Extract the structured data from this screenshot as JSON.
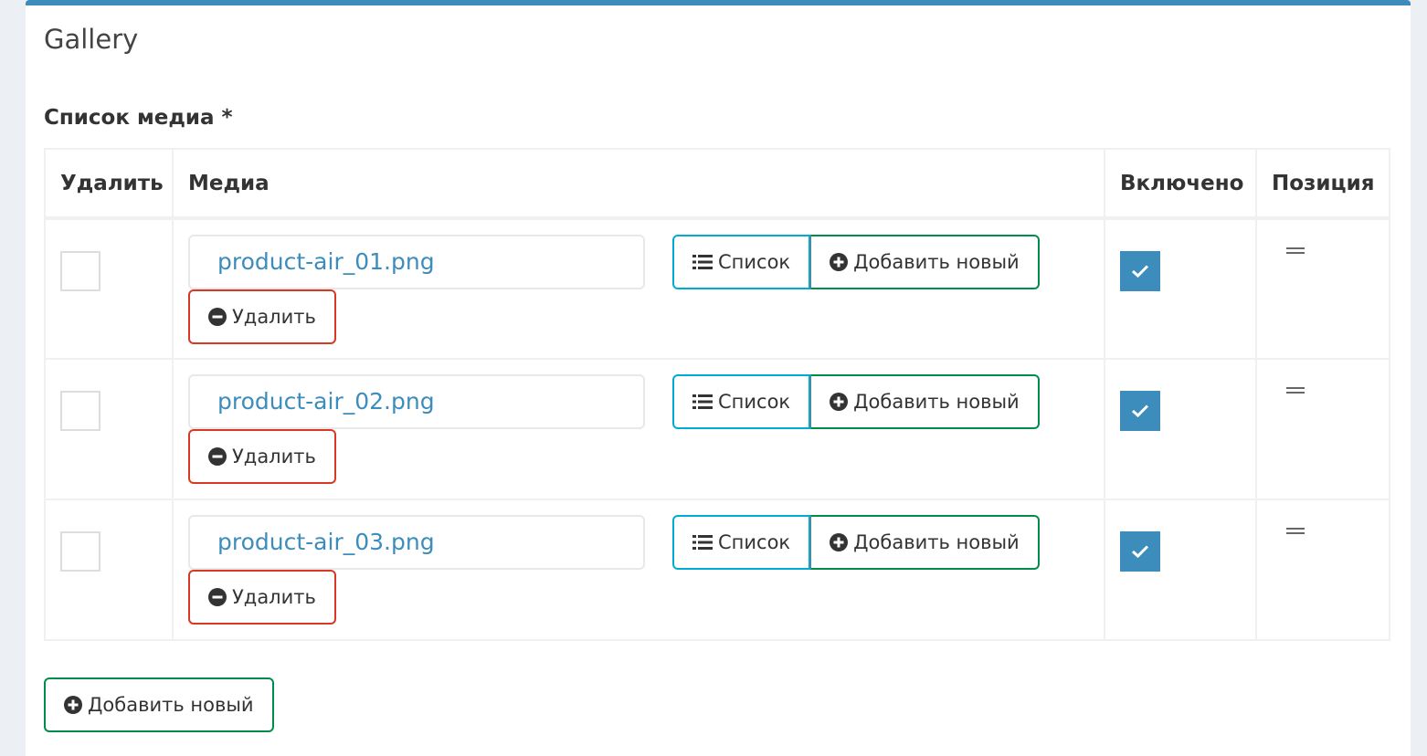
{
  "box": {
    "title": "Gallery"
  },
  "field": {
    "label": "Список медиа *"
  },
  "table": {
    "headers": {
      "delete": "Удалить",
      "media": "Медиа",
      "enabled": "Включено",
      "position": "Позиция"
    },
    "rows": [
      {
        "filename": "product-air_01.png",
        "delete_checked": false,
        "enabled": true
      },
      {
        "filename": "product-air_02.png",
        "delete_checked": false,
        "enabled": true
      },
      {
        "filename": "product-air_03.png",
        "delete_checked": false,
        "enabled": true
      }
    ]
  },
  "buttons": {
    "list_label": "Список",
    "add_new_label": "Добавить новый",
    "remove_label": "Удалить"
  },
  "footer": {
    "add_new_label": "Добавить новый"
  },
  "colors": {
    "accent": "#3c8dbc",
    "info": "#00acd6",
    "success": "#008d4c",
    "danger": "#d73925"
  },
  "icons": {
    "list": "list-icon",
    "add": "plus-circle-icon",
    "remove": "minus-circle-icon",
    "check": "check-icon",
    "drag": "drag-handle-icon"
  }
}
